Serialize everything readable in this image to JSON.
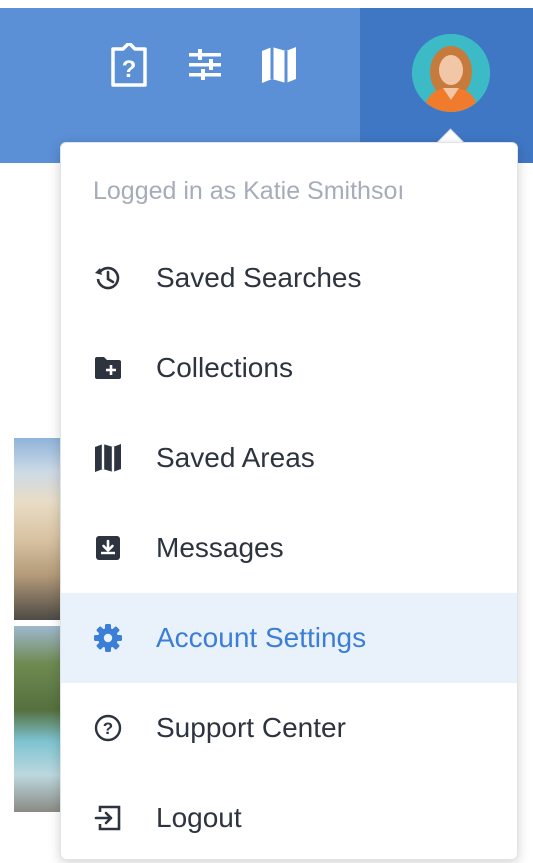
{
  "header": {
    "icons": [
      "help-icon",
      "sliders-icon",
      "map-icon"
    ],
    "avatar_icon": "user-avatar-icon"
  },
  "menu": {
    "logged_in_text": "Logged in as Katie Smithsoı",
    "items": [
      {
        "label": "Saved Searches",
        "icon": "history-icon"
      },
      {
        "label": "Collections",
        "icon": "folder-plus-icon"
      },
      {
        "label": "Saved Areas",
        "icon": "map-icon"
      },
      {
        "label": "Messages",
        "icon": "inbox-download-icon"
      },
      {
        "label": "Account Settings",
        "icon": "gear-icon",
        "active": true
      },
      {
        "label": "Support Center",
        "icon": "question-circle-icon"
      },
      {
        "label": "Logout",
        "icon": "logout-icon"
      }
    ]
  },
  "colors": {
    "header_blue": "#5b8fd6",
    "header_dark_blue": "#3f77c4",
    "active_text": "#3b7ed8",
    "active_bg": "#e9f1fb",
    "muted_text": "#a6adb8"
  }
}
